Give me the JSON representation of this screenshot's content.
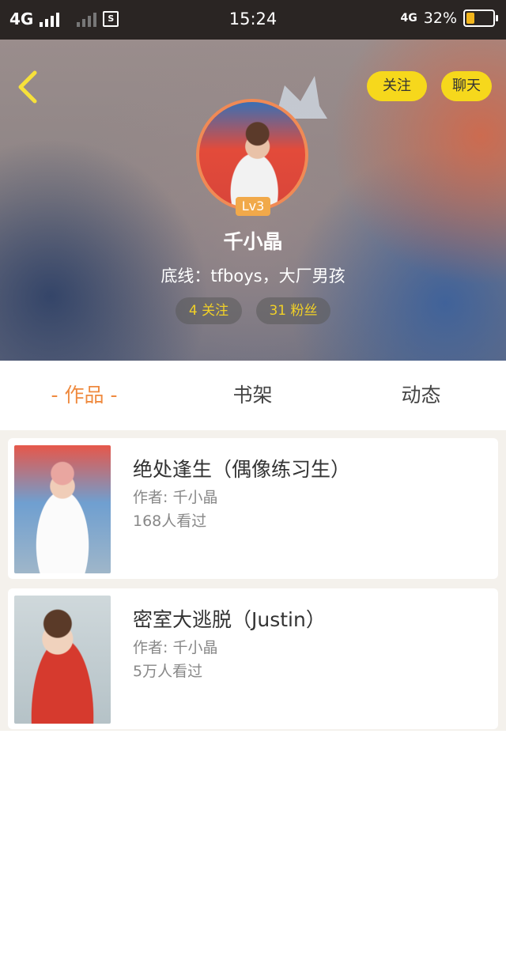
{
  "status_bar": {
    "network": "4G",
    "sim_icon": "sim-card-icon",
    "time": "15:24",
    "network_small": "4G",
    "battery_percent_label": "32%",
    "battery_level": 0.32,
    "battery_color": "#f1b51c"
  },
  "header": {
    "back_icon": "chevron-left-icon",
    "follow_label": "关注",
    "chat_label": "聊天",
    "accent_color": "#f6d81c",
    "level": "Lv3",
    "username": "千小晶",
    "bio": "底线：tfboys，大厂男孩",
    "following": "4 关注",
    "fans": "31 粉丝"
  },
  "tabs": [
    {
      "label": "- 作品 -",
      "active": true
    },
    {
      "label": "书架",
      "active": false
    },
    {
      "label": "动态",
      "active": false
    }
  ],
  "works": [
    {
      "title": "绝处逢生（偶像练习生）",
      "author": "作者: 千小晶",
      "views": "168人看过"
    },
    {
      "title": "密室大逃脱（Justin）",
      "author": "作者: 千小晶",
      "views": "5万人看过"
    }
  ]
}
